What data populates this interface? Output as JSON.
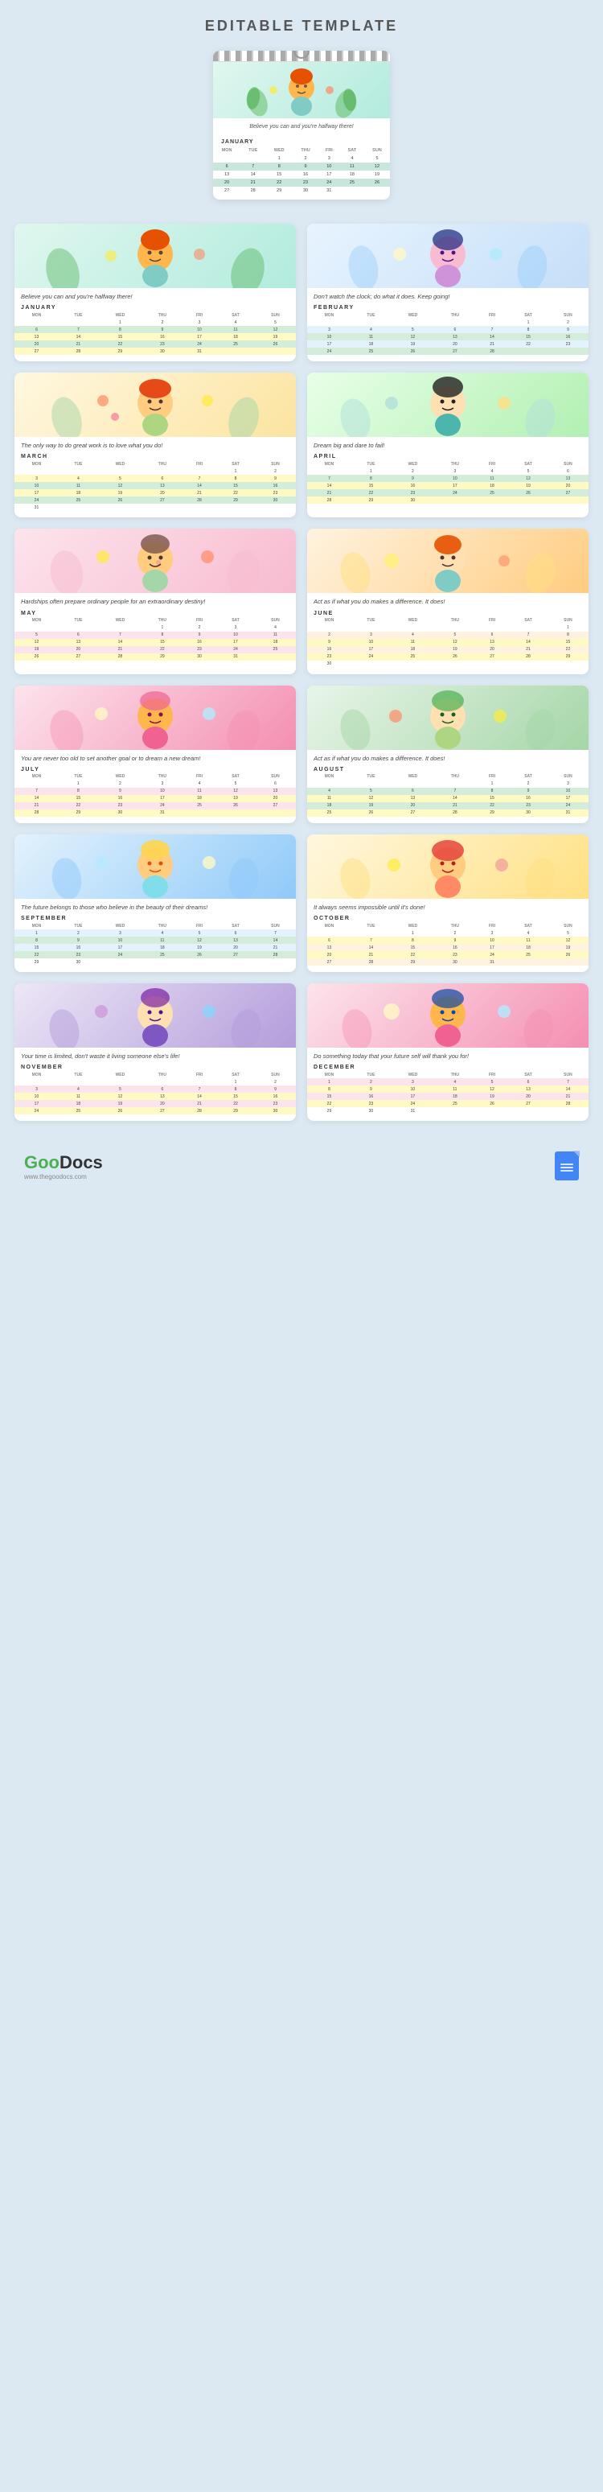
{
  "title": "EDITABLE TEMPLATE",
  "logo": {
    "goo": "Goo",
    "docs": "Docs",
    "subtitle": "www.thegoodocs.com",
    "docs_label": "Docs"
  },
  "main_calendar": {
    "quote": "Believe you can and you're halfway there!",
    "month": "JANUARY",
    "days": [
      "MON",
      "TUE",
      "WED",
      "THU",
      "FRI",
      "SAT",
      "SUN"
    ]
  },
  "months": [
    {
      "id": "jan",
      "name": "JANUARY",
      "quote": "Believe you can and you're halfway there!",
      "illus_class": "illus-jan",
      "days": [
        "MON",
        "TUE",
        "WED",
        "THU",
        "FRI",
        "SAT",
        "SUN"
      ],
      "weeks": [
        [
          "",
          "",
          "1",
          "2",
          "3",
          "4",
          "5"
        ],
        [
          "6",
          "7",
          "8",
          "9",
          "10",
          "11",
          "12"
        ],
        [
          "13",
          "14",
          "15",
          "16",
          "17",
          "18",
          "19"
        ],
        [
          "20",
          "21",
          "22",
          "23",
          "24",
          "25",
          "26"
        ],
        [
          "27",
          "28",
          "29",
          "30",
          "31",
          "",
          ""
        ]
      ],
      "row_colors": [
        "",
        "row-green",
        "row-yellow",
        "row-green",
        "row-yellow"
      ]
    },
    {
      "id": "feb",
      "name": "FEBRUARY",
      "quote": "Don't watch the clock; do what it does. Keep going!",
      "illus_class": "illus-feb",
      "days": [
        "MON",
        "TUE",
        "WED",
        "THU",
        "FRI",
        "SAT",
        "SUN"
      ],
      "weeks": [
        [
          "",
          "",
          "",
          "",
          "",
          "1",
          "2"
        ],
        [
          "3",
          "4",
          "5",
          "6",
          "7",
          "8",
          "9"
        ],
        [
          "10",
          "11",
          "12",
          "13",
          "14",
          "15",
          "16"
        ],
        [
          "17",
          "18",
          "19",
          "20",
          "21",
          "22",
          "23"
        ],
        [
          "24",
          "25",
          "26",
          "27",
          "28",
          "",
          ""
        ]
      ],
      "row_colors": [
        "",
        "row-blue",
        "row-green",
        "row-blue",
        "row-green"
      ]
    },
    {
      "id": "mar",
      "name": "MARCH",
      "quote": "The only way to do great work is to love what you do!",
      "illus_class": "illus-mar",
      "days": [
        "MON",
        "TUE",
        "WED",
        "THU",
        "FRI",
        "SAT",
        "SUN"
      ],
      "weeks": [
        [
          "",
          "",
          "",
          "",
          "",
          "1",
          "2"
        ],
        [
          "3",
          "4",
          "5",
          "6",
          "7",
          "8",
          "9"
        ],
        [
          "10",
          "11",
          "12",
          "13",
          "14",
          "15",
          "16"
        ],
        [
          "17",
          "18",
          "19",
          "20",
          "21",
          "22",
          "23"
        ],
        [
          "24",
          "25",
          "26",
          "27",
          "28",
          "29",
          "30"
        ],
        [
          "31",
          "",
          "",
          "",
          "",
          "",
          ""
        ]
      ],
      "row_colors": [
        "",
        "row-yellow",
        "row-green",
        "row-yellow",
        "row-green",
        ""
      ]
    },
    {
      "id": "apr",
      "name": "APRIL",
      "quote": "Dream big and dare to fail!",
      "illus_class": "illus-apr",
      "days": [
        "MON",
        "TUE",
        "WED",
        "THU",
        "FRI",
        "SAT",
        "SUN"
      ],
      "weeks": [
        [
          "",
          "1",
          "2",
          "3",
          "4",
          "5",
          "6"
        ],
        [
          "7",
          "8",
          "9",
          "10",
          "11",
          "12",
          "13"
        ],
        [
          "14",
          "15",
          "16",
          "17",
          "18",
          "19",
          "20"
        ],
        [
          "21",
          "22",
          "23",
          "24",
          "25",
          "26",
          "27"
        ],
        [
          "28",
          "29",
          "30",
          "",
          "",
          "",
          ""
        ]
      ],
      "row_colors": [
        "",
        "row-green",
        "row-yellow",
        "row-green",
        "row-yellow"
      ]
    },
    {
      "id": "may",
      "name": "MAY",
      "quote": "Hardships often prepare ordinary people for an extraordinary destiny!",
      "illus_class": "illus-may",
      "days": [
        "MON",
        "TUE",
        "WED",
        "THU",
        "FRI",
        "SAT",
        "SUN"
      ],
      "weeks": [
        [
          "",
          "",
          "",
          "1",
          "2",
          "3",
          "4"
        ],
        [
          "5",
          "6",
          "7",
          "8",
          "9",
          "10",
          "11"
        ],
        [
          "12",
          "13",
          "14",
          "15",
          "16",
          "17",
          "18"
        ],
        [
          "19",
          "20",
          "21",
          "22",
          "23",
          "24",
          "25"
        ],
        [
          "26",
          "27",
          "28",
          "29",
          "30",
          "31",
          ""
        ]
      ],
      "row_colors": [
        "",
        "row-pink",
        "row-yellow",
        "row-pink",
        "row-yellow"
      ]
    },
    {
      "id": "jun",
      "name": "JUNE",
      "quote": "Act as if what you do makes a difference. It does!",
      "illus_class": "illus-jun",
      "days": [
        "MON",
        "TUE",
        "WED",
        "THU",
        "FRI",
        "SAT",
        "SUN"
      ],
      "weeks": [
        [
          "",
          "",
          "",
          "",
          "",
          "",
          "1"
        ],
        [
          "2",
          "3",
          "4",
          "5",
          "6",
          "7",
          "8"
        ],
        [
          "9",
          "10",
          "11",
          "12",
          "13",
          "14",
          "15"
        ],
        [
          "16",
          "17",
          "18",
          "19",
          "20",
          "21",
          "22"
        ],
        [
          "23",
          "24",
          "25",
          "26",
          "27",
          "28",
          "29"
        ],
        [
          "30",
          "",
          "",
          "",
          "",
          "",
          ""
        ]
      ],
      "row_colors": [
        "",
        "row-orange",
        "row-yellow",
        "row-orange",
        "row-yellow",
        ""
      ]
    },
    {
      "id": "jul",
      "name": "JULY",
      "quote": "You are never too old to set another goal or to dream a new dream!",
      "illus_class": "illus-jul",
      "days": [
        "MON",
        "TUE",
        "WED",
        "THU",
        "FRI",
        "SAT",
        "SUN"
      ],
      "weeks": [
        [
          "",
          "1",
          "2",
          "3",
          "4",
          "5",
          "6"
        ],
        [
          "7",
          "8",
          "9",
          "10",
          "11",
          "12",
          "13"
        ],
        [
          "14",
          "15",
          "16",
          "17",
          "18",
          "19",
          "20"
        ],
        [
          "21",
          "22",
          "23",
          "24",
          "25",
          "26",
          "27"
        ],
        [
          "28",
          "29",
          "30",
          "31",
          "",
          "",
          ""
        ]
      ],
      "row_colors": [
        "",
        "row-pink",
        "row-yellow",
        "row-pink",
        "row-yellow"
      ]
    },
    {
      "id": "aug",
      "name": "AUGUST",
      "quote": "Act as if what you do makes a difference. It does!",
      "illus_class": "illus-aug",
      "days": [
        "MON",
        "TUE",
        "WED",
        "THU",
        "FRI",
        "SAT",
        "SUN"
      ],
      "weeks": [
        [
          "",
          "",
          "",
          "",
          "1",
          "2",
          "3"
        ],
        [
          "4",
          "5",
          "6",
          "7",
          "8",
          "9",
          "10"
        ],
        [
          "11",
          "12",
          "13",
          "14",
          "15",
          "16",
          "17"
        ],
        [
          "18",
          "19",
          "20",
          "21",
          "22",
          "23",
          "24"
        ],
        [
          "25",
          "26",
          "27",
          "28",
          "29",
          "30",
          "31"
        ]
      ],
      "row_colors": [
        "",
        "row-green",
        "row-yellow",
        "row-green",
        "row-yellow"
      ]
    },
    {
      "id": "sep",
      "name": "SEPTEMBER",
      "quote": "The future belongs to those who believe in the beauty of their dreams!",
      "illus_class": "illus-sep",
      "days": [
        "MON",
        "TUE",
        "WED",
        "THU",
        "FRI",
        "SAT",
        "SUN"
      ],
      "weeks": [
        [
          "1",
          "2",
          "3",
          "4",
          "5",
          "6",
          "7"
        ],
        [
          "8",
          "9",
          "10",
          "11",
          "12",
          "13",
          "14"
        ],
        [
          "15",
          "16",
          "17",
          "18",
          "19",
          "20",
          "21"
        ],
        [
          "22",
          "23",
          "24",
          "25",
          "26",
          "27",
          "28"
        ],
        [
          "29",
          "30",
          "",
          "",
          "",
          "",
          ""
        ]
      ],
      "row_colors": [
        "row-blue",
        "row-green",
        "row-blue",
        "row-green",
        ""
      ]
    },
    {
      "id": "oct",
      "name": "OCTOBER",
      "quote": "It always seems impossible until it's done!",
      "illus_class": "illus-oct",
      "days": [
        "MON",
        "TUE",
        "WED",
        "THU",
        "FRI",
        "SAT",
        "SUN"
      ],
      "weeks": [
        [
          "",
          "",
          "1",
          "2",
          "3",
          "4",
          "5"
        ],
        [
          "6",
          "7",
          "8",
          "9",
          "10",
          "11",
          "12"
        ],
        [
          "13",
          "14",
          "15",
          "16",
          "17",
          "18",
          "19"
        ],
        [
          "20",
          "21",
          "22",
          "23",
          "24",
          "25",
          "26"
        ],
        [
          "27",
          "28",
          "29",
          "30",
          "31",
          "",
          ""
        ]
      ],
      "row_colors": [
        "",
        "row-yellow",
        "row-orange",
        "row-yellow",
        "row-orange"
      ]
    },
    {
      "id": "nov",
      "name": "NOVEMBER",
      "quote": "Your time is limited, don't waste it living someone else's life!",
      "illus_class": "illus-nov",
      "days": [
        "MON",
        "TUE",
        "WED",
        "THU",
        "FRI",
        "SAT",
        "SUN"
      ],
      "weeks": [
        [
          "",
          "",
          "",
          "",
          "",
          "1",
          "2"
        ],
        [
          "3",
          "4",
          "5",
          "6",
          "7",
          "8",
          "9"
        ],
        [
          "10",
          "11",
          "12",
          "13",
          "14",
          "15",
          "16"
        ],
        [
          "17",
          "18",
          "19",
          "20",
          "21",
          "22",
          "23"
        ],
        [
          "24",
          "25",
          "26",
          "27",
          "28",
          "29",
          "30"
        ]
      ],
      "row_colors": [
        "",
        "row-pink",
        "row-yellow",
        "row-pink",
        "row-yellow"
      ]
    },
    {
      "id": "dec",
      "name": "DECEMBER",
      "quote": "Do something today that your future self will thank you for!",
      "illus_class": "illus-dec",
      "days": [
        "MON",
        "TUE",
        "WED",
        "THU",
        "FRI",
        "SAT",
        "SUN"
      ],
      "weeks": [
        [
          "1",
          "2",
          "3",
          "4",
          "5",
          "6",
          "7"
        ],
        [
          "8",
          "9",
          "10",
          "11",
          "12",
          "13",
          "14"
        ],
        [
          "15",
          "16",
          "17",
          "18",
          "19",
          "20",
          "21"
        ],
        [
          "22",
          "23",
          "24",
          "25",
          "26",
          "27",
          "28"
        ],
        [
          "29",
          "30",
          "31",
          "",
          "",
          "",
          ""
        ]
      ],
      "row_colors": [
        "row-pink",
        "row-yellow",
        "row-pink",
        "row-yellow",
        ""
      ]
    }
  ]
}
